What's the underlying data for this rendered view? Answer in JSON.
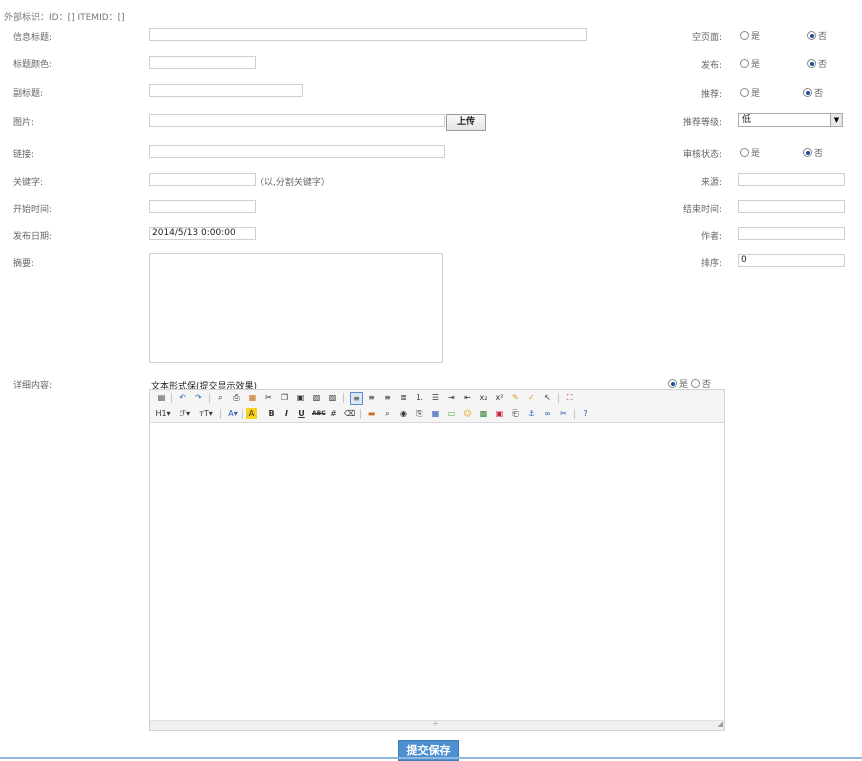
{
  "header": {
    "external_id_text": "外部标识：ID：[] ITEMID：[]"
  },
  "form": {
    "title_label": "信息标题:",
    "title_color_label": "标题颜色:",
    "subtitle_label": "副标题:",
    "image_label": "图片:",
    "upload_button": "上传",
    "link_label": "链接:",
    "keywords_label": "关键字:",
    "keywords_hint": "（以,分割关键字）",
    "start_time_label": "开始时间:",
    "publish_date_label": "发布日期:",
    "publish_date_value": "2014/5/13 0:00:00",
    "summary_label": "摘要:",
    "details_label": "详细内容:",
    "text_mode_label": "文本形式保(提交显示效果)"
  },
  "right": {
    "empty_page_label": "空页面:",
    "publish_label": "发布:",
    "recommend_label": "推荐:",
    "recommend_level_label": "推荐等级:",
    "recommend_level_value": "低",
    "review_status_label": "审核状态:",
    "source_label": "来源:",
    "end_time_label": "结束时间:",
    "author_label": "作者:",
    "sort_label": "排序:",
    "sort_value": "0",
    "yes": "是",
    "no": "否"
  },
  "editor": {
    "toolbar_row2_texts": {
      "h1": "H1▾",
      "font": "ℱ▾",
      "size": "тT▾",
      "bold": "B",
      "italic": "I",
      "underline": "U",
      "strike": "ABC"
    }
  },
  "submit_button": "提交保存",
  "colors": {
    "accent": "#4d8fd0",
    "radio_checked": "#1b4f9c",
    "border": "#cfcfcf"
  }
}
